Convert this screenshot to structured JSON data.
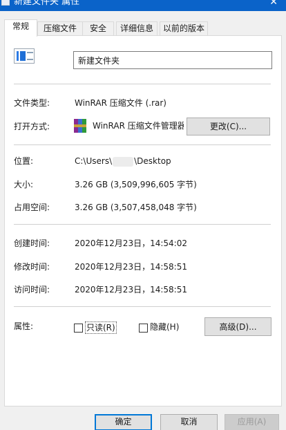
{
  "window": {
    "title": "新建文件夹 属性",
    "close_glyph": "✕"
  },
  "tabs": [
    {
      "label": "常规",
      "active": true
    },
    {
      "label": "压缩文件",
      "active": false
    },
    {
      "label": "安全",
      "active": false
    },
    {
      "label": "详细信息",
      "active": false
    },
    {
      "label": "以前的版本",
      "active": false
    }
  ],
  "general": {
    "name_value": "新建文件夹",
    "file_type_label": "文件类型:",
    "file_type_value": "WinRAR 压缩文件 (.rar)",
    "open_with_label": "打开方式:",
    "open_with_value": "WinRAR 压缩文件管理器",
    "change_button": "更改(C)...",
    "location_label": "位置:",
    "location_prefix": "C:\\Users\\",
    "location_suffix": "\\Desktop",
    "size_label": "大小:",
    "size_value": "3.26 GB (3,509,996,605 字节)",
    "size_on_disk_label": "占用空间:",
    "size_on_disk_value": "3.26 GB (3,507,458,048 字节)",
    "created_label": "创建时间:",
    "created_value": "2020年12月23日，14:54:02",
    "modified_label": "修改时间:",
    "modified_value": "2020年12月23日，14:58:51",
    "accessed_label": "访问时间:",
    "accessed_value": "2020年12月23日，14:58:51",
    "attributes_label": "属性:",
    "readonly_label": "只读(R)",
    "readonly_checked": false,
    "hidden_label": "隐藏(H)",
    "hidden_checked": false,
    "advanced_button": "高级(D)..."
  },
  "footer": {
    "ok": "确定",
    "cancel": "取消",
    "apply": "应用(A)"
  },
  "icons": {
    "folder": "folder-icon",
    "winrar": "winrar-icon"
  },
  "colors": {
    "titlebar": "#0a63c9",
    "default_button_border": "#0078d7"
  }
}
